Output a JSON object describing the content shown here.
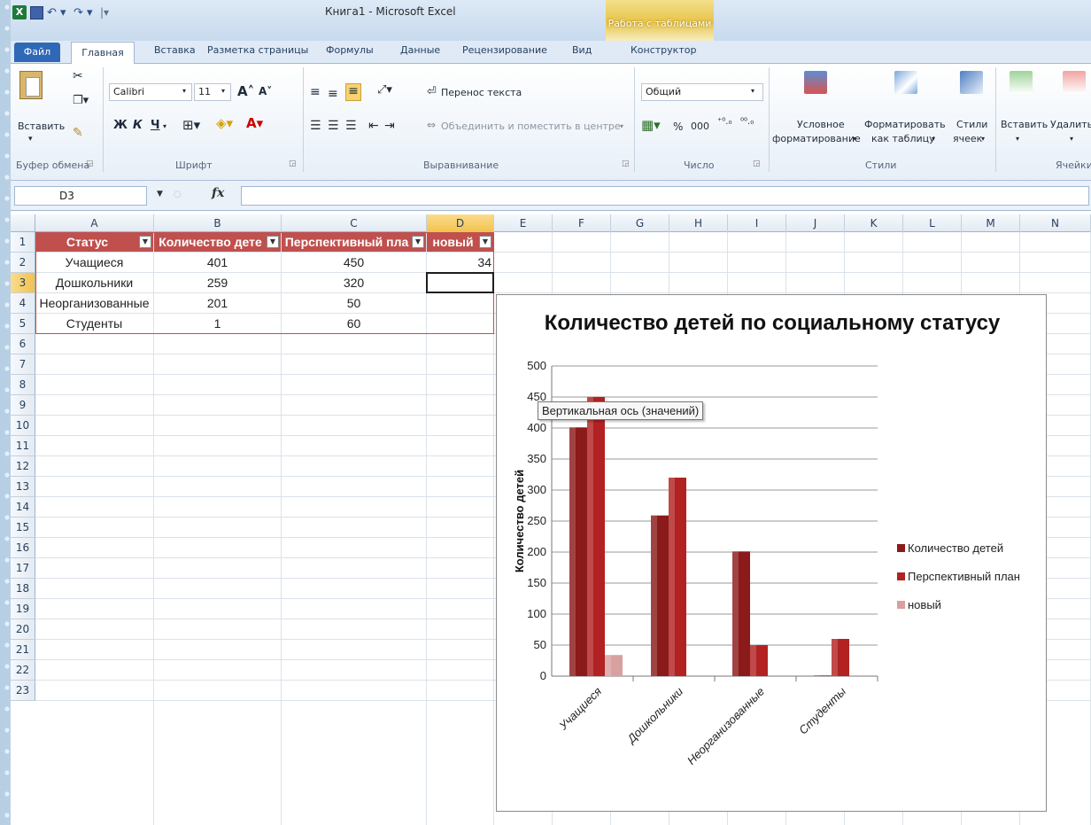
{
  "window": {
    "title": "Книга1 - Microsoft Excel",
    "context_group": "Работа с таблицами"
  },
  "tabs": [
    "Файл",
    "Главная",
    "Вставка",
    "Разметка страницы",
    "Формулы",
    "Данные",
    "Рецензирование",
    "Вид",
    "Конструктор"
  ],
  "ribbon": {
    "paste": "Вставить",
    "clipboard_group": "Буфер обмена",
    "font_name": "Calibri",
    "font_size": "11",
    "bold": "Ж",
    "italic": "К",
    "underline": "Ч",
    "font_group": "Шрифт",
    "wrap_text": "Перенос текста",
    "merge_center": "Объединить и поместить в центре",
    "alignment_group": "Выравнивание",
    "number_format": "Общий",
    "percent": "%",
    "thousands": "000",
    "number_group": "Число",
    "conditional_1": "Условное",
    "conditional_2": "форматирование",
    "format_table_1": "Форматировать",
    "format_table_2": "как таблицу",
    "cell_styles_1": "Стили",
    "cell_styles_2": "ячеек",
    "styles_group": "Стили",
    "insert": "Вставить",
    "delete": "Удалить",
    "cells_group": "Ячейки"
  },
  "formula_bar": {
    "name_box": "D3",
    "fx": "fx",
    "value": ""
  },
  "columns": [
    "A",
    "B",
    "C",
    "D",
    "E",
    "F",
    "G",
    "H",
    "I",
    "J",
    "K",
    "L",
    "M",
    "N"
  ],
  "rows": [
    "1",
    "2",
    "3",
    "4",
    "5",
    "6",
    "7",
    "8",
    "9",
    "10",
    "11",
    "12",
    "13",
    "14",
    "15",
    "16",
    "17",
    "18",
    "19",
    "20",
    "21",
    "22",
    "23"
  ],
  "table": {
    "headers": [
      "Статус",
      "Количество дете",
      "Перспективный пла",
      "новый"
    ],
    "data": [
      [
        "Учащиеся",
        "401",
        "450",
        "34"
      ],
      [
        "Дошкольники",
        "259",
        "320",
        ""
      ],
      [
        "Неорганизованные",
        "201",
        "50",
        ""
      ],
      [
        "Студенты",
        "1",
        "60",
        ""
      ]
    ]
  },
  "tooltip": "Вертикальная ось (значений)",
  "chart_data": {
    "type": "bar",
    "title": "Количество детей по социальному статусу",
    "ylabel": "Количество детей",
    "xlabel": "",
    "categories": [
      "Учащиеся",
      "Дошкольники",
      "Неорганизованные",
      "Студенты"
    ],
    "series": [
      {
        "name": "Количество детей",
        "values": [
          401,
          259,
          201,
          1
        ],
        "color": "#8b1a1a"
      },
      {
        "name": "Перспективный план",
        "values": [
          450,
          320,
          50,
          60
        ],
        "color": "#b22222"
      },
      {
        "name": "новый",
        "values": [
          34,
          0,
          0,
          0
        ],
        "color": "#d9a0a0"
      }
    ],
    "ylim": [
      0,
      500
    ],
    "yticks": [
      "0",
      "50",
      "100",
      "150",
      "200",
      "250",
      "300",
      "350",
      "400",
      "450",
      "500"
    ],
    "grid": true,
    "legend": "right"
  },
  "colors": {
    "table_header": "#c0504d",
    "selection": "#f2c24c"
  }
}
